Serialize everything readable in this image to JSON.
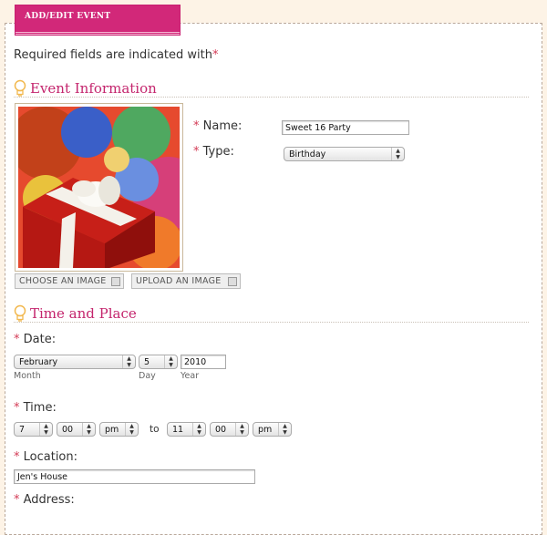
{
  "tab": {
    "label": "ADD/EDIT EVENT"
  },
  "required_note": {
    "text": "Required fields are indicated with",
    "mark": "*"
  },
  "sections": {
    "event_info": "Event Information",
    "time_place": "Time and Place"
  },
  "image_buttons": {
    "choose": "CHOOSE AN IMAGE",
    "upload": "UPLOAD AN IMAGE"
  },
  "fields": {
    "name": {
      "label": "Name:",
      "value": "Sweet 16 Party"
    },
    "type": {
      "label": "Type:",
      "value": "Birthday"
    },
    "date": {
      "label": "Date:",
      "month": "February",
      "day": "5",
      "year": "2010",
      "month_caption": "Month",
      "day_caption": "Day",
      "year_caption": "Year"
    },
    "time": {
      "label": "Time:",
      "start_hour": "7",
      "start_min": "00",
      "start_ampm": "pm",
      "to": "to",
      "end_hour": "11",
      "end_min": "00",
      "end_ampm": "pm"
    },
    "location": {
      "label": "Location:",
      "value": "Jen's House"
    },
    "address": {
      "label": "Address:"
    }
  },
  "colors": {
    "accent": "#d22879",
    "asterisk": "#d33a55",
    "background": "#fdf3e6"
  }
}
